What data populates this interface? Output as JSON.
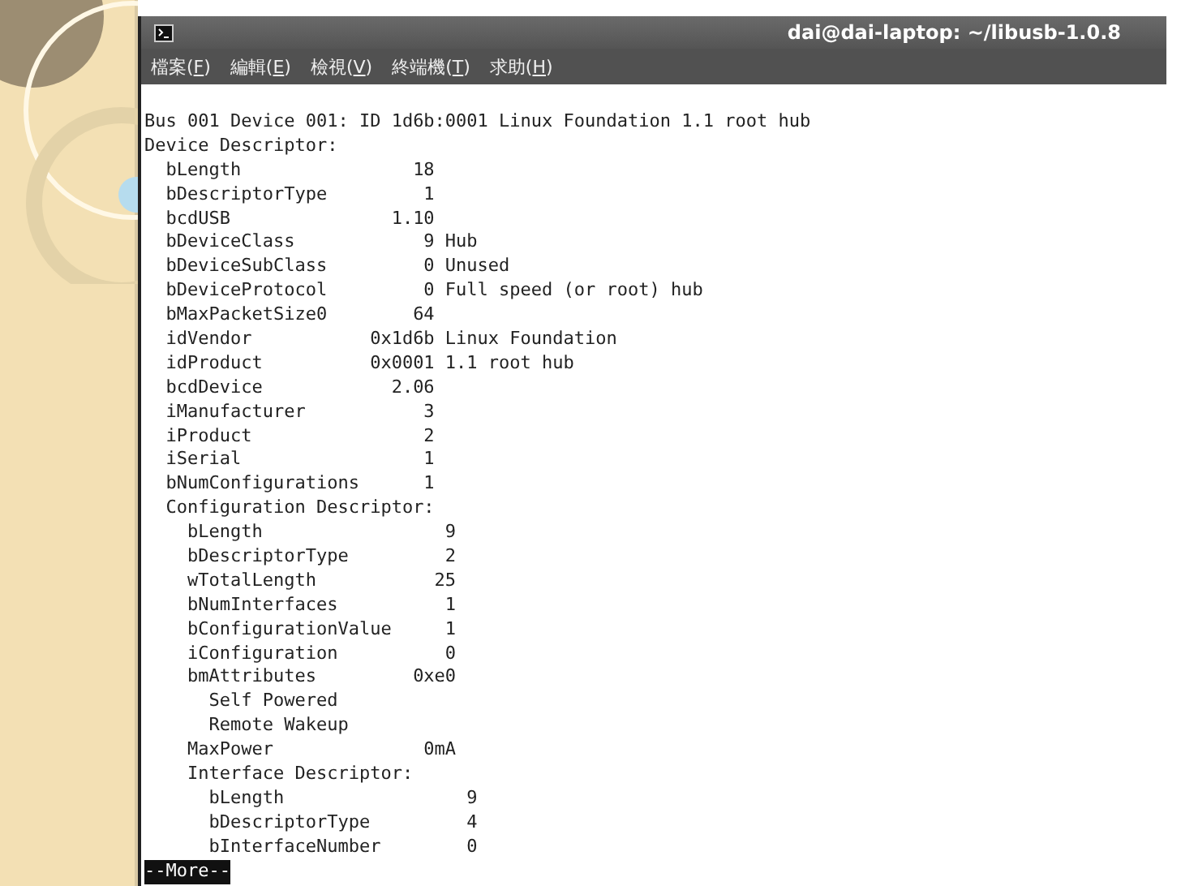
{
  "window": {
    "title": "dai@dai-laptop: ~/libusb-1.0.8"
  },
  "menu": [
    {
      "before": "檔案(",
      "key": "F",
      "after": ")"
    },
    {
      "before": "編輯(",
      "key": "E",
      "after": ")"
    },
    {
      "before": "檢視(",
      "key": "V",
      "after": ")"
    },
    {
      "before": "終端機(",
      "key": "T",
      "after": ")"
    },
    {
      "before": "求助(",
      "key": "H",
      "after": ")"
    }
  ],
  "terminal": {
    "lines": [
      "Bus 001 Device 001: ID 1d6b:0001 Linux Foundation 1.1 root hub",
      "Device Descriptor:",
      "  bLength                18",
      "  bDescriptorType         1",
      "  bcdUSB               1.10",
      "  bDeviceClass            9 Hub",
      "  bDeviceSubClass         0 Unused",
      "  bDeviceProtocol         0 Full speed (or root) hub",
      "  bMaxPacketSize0        64",
      "  idVendor           0x1d6b Linux Foundation",
      "  idProduct          0x0001 1.1 root hub",
      "  bcdDevice            2.06",
      "  iManufacturer           3",
      "  iProduct                2",
      "  iSerial                 1",
      "  bNumConfigurations      1",
      "  Configuration Descriptor:",
      "    bLength                 9",
      "    bDescriptorType         2",
      "    wTotalLength           25",
      "    bNumInterfaces          1",
      "    bConfigurationValue     1",
      "    iConfiguration          0",
      "    bmAttributes         0xe0",
      "      Self Powered",
      "      Remote Wakeup",
      "    MaxPower              0mA",
      "    Interface Descriptor:",
      "      bLength                 9",
      "      bDescriptorType         4",
      "      bInterfaceNumber        0"
    ],
    "pager_prompt": "--More--"
  }
}
